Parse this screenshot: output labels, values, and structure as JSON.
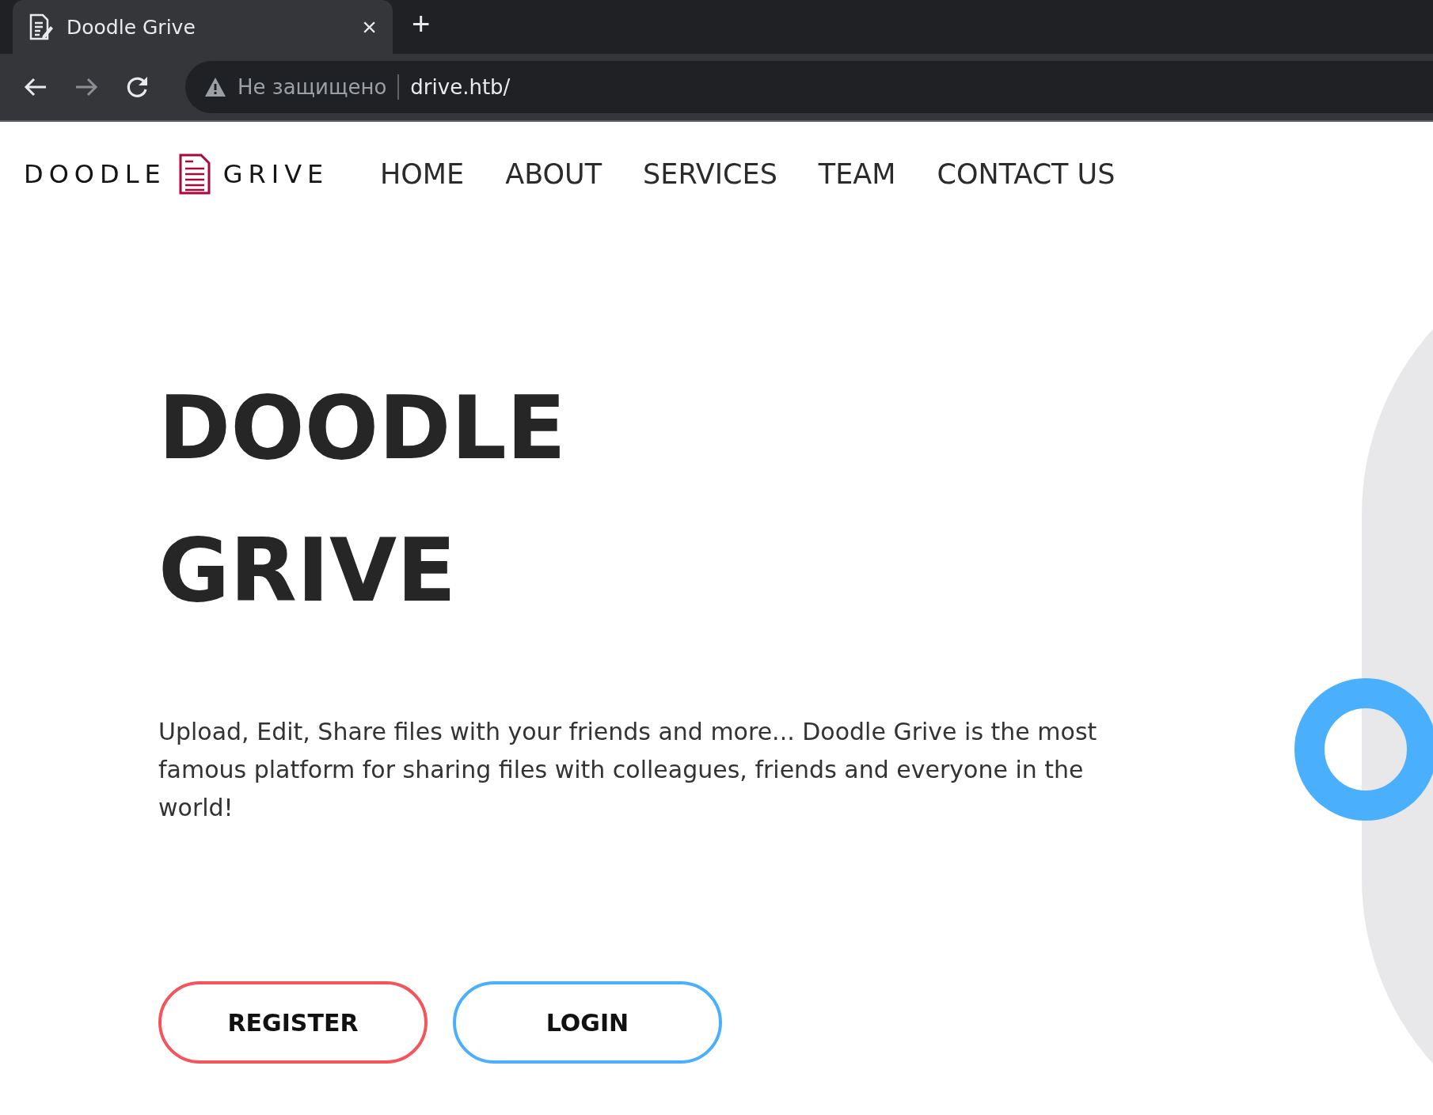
{
  "browser": {
    "tab": {
      "title": "Doodle Grive",
      "close": "×",
      "new_tab": "+"
    },
    "security": "Не защищено",
    "url": "drive.htb/"
  },
  "logo": {
    "left": "DOODLE",
    "right": "GRIVE"
  },
  "nav": [
    {
      "label": "HOME"
    },
    {
      "label": "ABOUT"
    },
    {
      "label": "SERVICES"
    },
    {
      "label": "TEAM"
    },
    {
      "label": "CONTACT US"
    }
  ],
  "hero": {
    "title_lines": [
      "DOODLE",
      "GRIVE"
    ],
    "text": "Upload, Edit, Share files with your friends and more... Doodle Grive is the most famous platform for sharing files with colleagues, friends and everyone in the world!"
  },
  "buttons": [
    {
      "label": "REGISTER",
      "color": "#f4545a"
    },
    {
      "label": "LOGIN",
      "color": "#4aaffc"
    }
  ]
}
